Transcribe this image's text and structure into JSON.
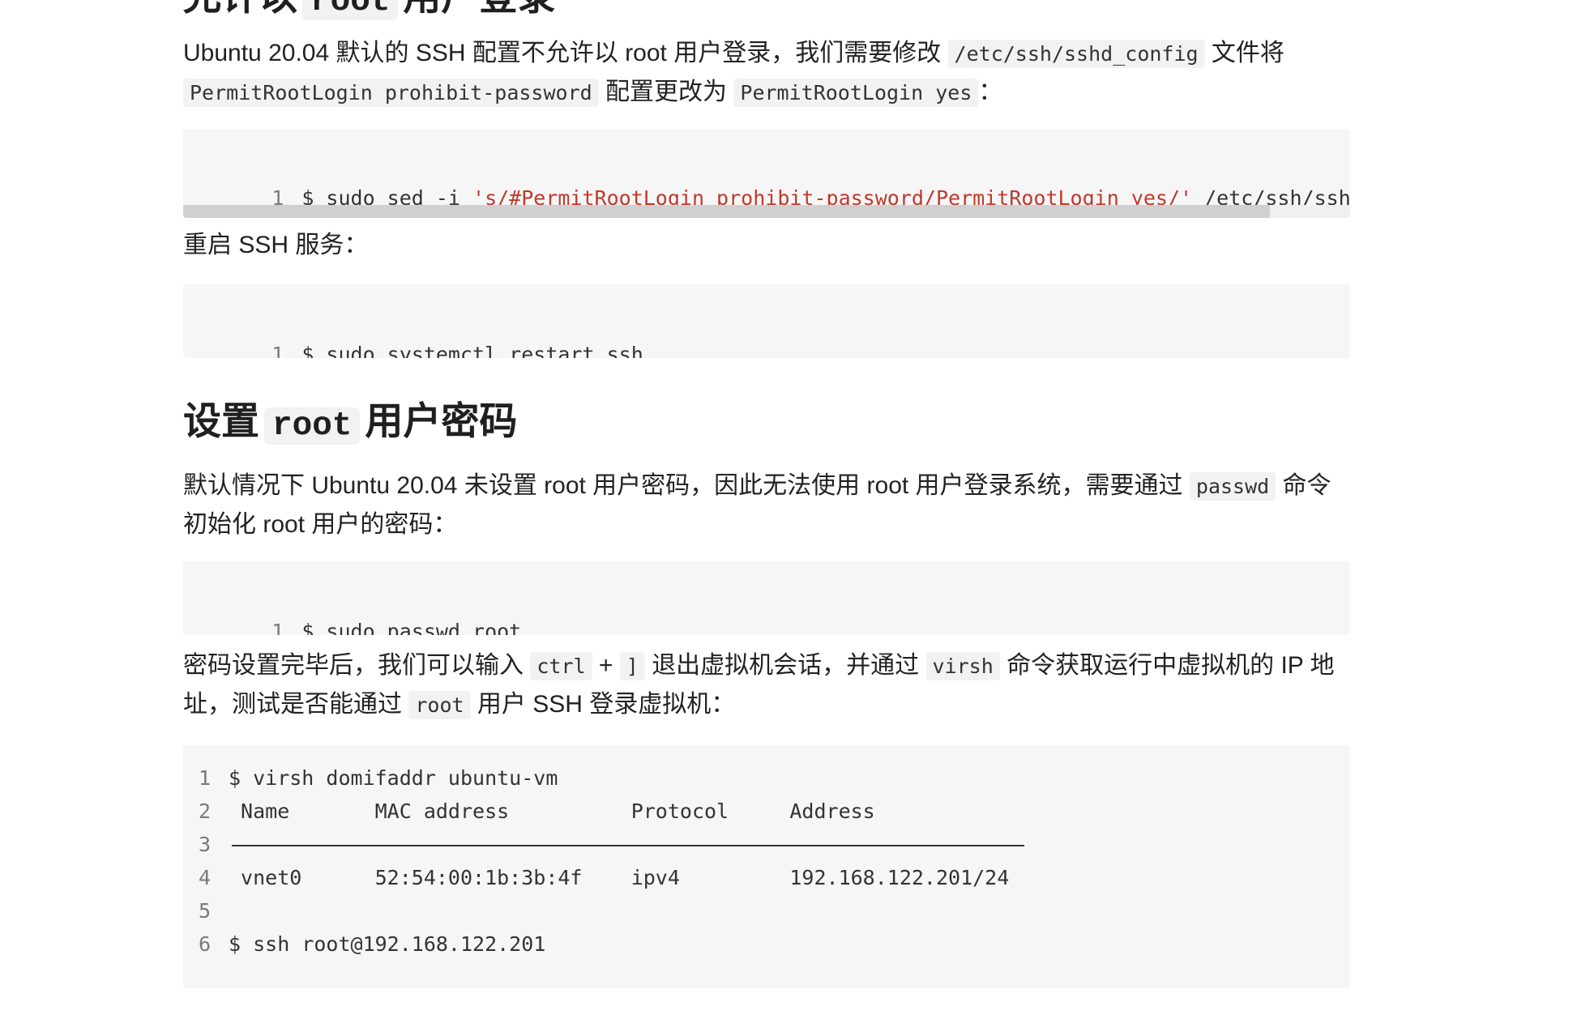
{
  "section1": {
    "heading_prefix": "允许以",
    "heading_code": "root",
    "heading_suffix": "用户登录",
    "para_part1": "Ubuntu 20.04 默认的 SSH 配置不允许以 root 用户登录，我们需要修改",
    "para_code1": "/etc/ssh/sshd_config",
    "para_part2": "文件将",
    "para_code2": "PermitRootLogin prohibit-password",
    "para_part3": "配置更改为",
    "para_code3": "PermitRootLogin yes",
    "para_part4": "：",
    "code1": {
      "line_no": "1",
      "cmd": "$ sudo sed -i ",
      "string": "'s/#PermitRootLogin prohibit-password/PermitRootLogin yes/'",
      "rest": " /etc/ssh/sshd_config"
    },
    "restart_text": "重启 SSH 服务：",
    "code2": {
      "line_no": "1",
      "cmd": "$ sudo systemctl restart ssh"
    }
  },
  "section2": {
    "heading_prefix": "设置",
    "heading_code": "root",
    "heading_suffix": "用户密码",
    "para1_part1": "默认情况下 Ubuntu 20.04 未设置 root 用户密码，因此无法使用 root 用户登录系统，需要通过",
    "para1_code": "passwd",
    "para1_part2": "命令初始化 root 用户的密码：",
    "code3": {
      "line_no": "1",
      "cmd": "$ sudo passwd root"
    },
    "para2_part1": "密码设置完毕后，我们可以输入",
    "para2_code1": "ctrl",
    "para2_plus": "+",
    "para2_code2": "]",
    "para2_part2": "退出虚拟机会话，并通过",
    "para2_code3": "virsh",
    "para2_part3": "命令获取运行中虚拟机的 IP 地址，测试是否能通过",
    "para2_code4": "root",
    "para2_part4": "用户 SSH 登录虚拟机：",
    "code4": {
      "lines": [
        {
          "n": "1",
          "text": "$ virsh domifaddr ubuntu-vm"
        },
        {
          "n": "2",
          "text": " Name       MAC address          Protocol     Address"
        },
        {
          "n": "3",
          "text": ""
        },
        {
          "n": "4",
          "text": " vnet0      52:54:00:1b:3b:4f    ipv4         192.168.122.201/24"
        },
        {
          "n": "5",
          "text": ""
        },
        {
          "n": "6",
          "text": "$ ssh root@192.168.122.201"
        }
      ]
    }
  }
}
